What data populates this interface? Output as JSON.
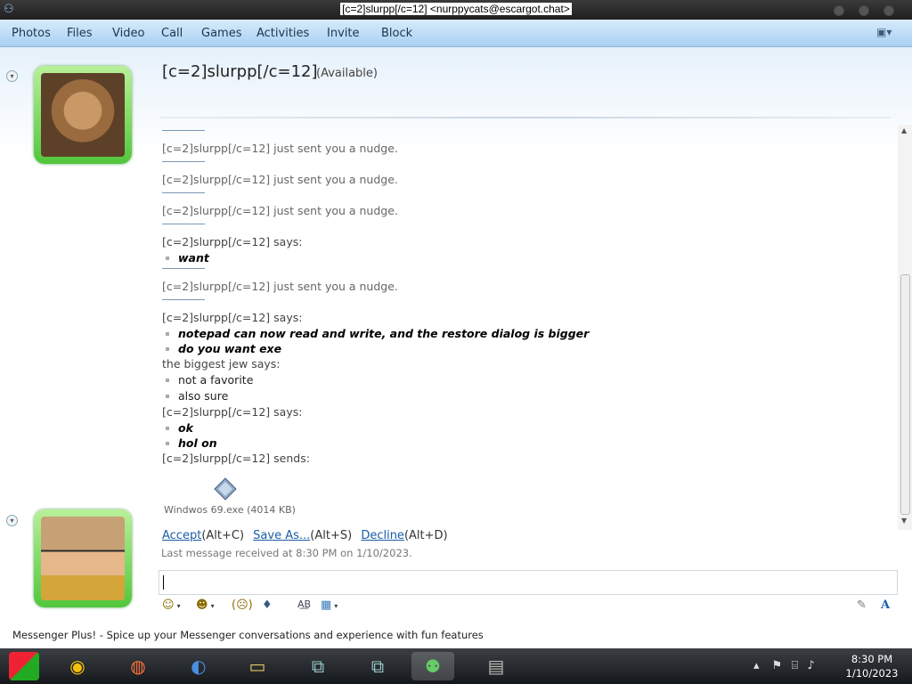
{
  "window": {
    "title": "[c=2]slurpp[/c=12] <nurppycats@escargot.chat>"
  },
  "menu": {
    "items": [
      "Photos",
      "Files",
      "Video",
      "Call",
      "Games",
      "Activities",
      "Invite",
      "Block"
    ]
  },
  "contact": {
    "name": "[c=2]slurpp[/c=12]",
    "status": "(Available)"
  },
  "conversation": {
    "nudges": [
      "[c=2]slurpp[/c=12] just sent you a nudge.",
      "[c=2]slurpp[/c=12] just sent you a nudge.",
      "[c=2]slurpp[/c=12] just sent you a nudge."
    ],
    "block1_says": "[c=2]slurpp[/c=12] says:",
    "block1_msg": "want",
    "nudge4": "[c=2]slurpp[/c=12] just sent you a nudge.",
    "block2_says": "[c=2]slurpp[/c=12] says:",
    "block2_msgs": [
      "notepad can now read and write, and the restore dialog is bigger",
      "do you want exe"
    ],
    "block3_says": "the biggest jew says:",
    "block3_msgs": [
      "not a favorite",
      "also sure"
    ],
    "block4_says": "[c=2]slurpp[/c=12] says:",
    "block4_msgs": [
      "ok",
      "hol on"
    ],
    "block5_sends": "[c=2]slurpp[/c=12] sends:"
  },
  "file_transfer": {
    "file": "Windwos 69.exe (4014 KB)",
    "accept": "Accept",
    "accept_key": "(Alt+C)",
    "save_as": "Save As...",
    "save_key": "(Alt+S)",
    "decline": "Decline",
    "decline_key": "(Alt+D)"
  },
  "status_line": "Last message received at 8:30 PM on 1/10/2023.",
  "plus_banner": "Messenger Plus! - Spice up your Messenger conversations and experience with fun features",
  "clock": {
    "time": "8:30 PM",
    "date": "1/10/2023"
  },
  "icons": {
    "emoticon": "smile-icon",
    "wink": "wink-icon",
    "nudge": "nudge-icon",
    "voice_clip": "voice-clip-icon",
    "spell": "spell-check-icon",
    "background": "background-icon",
    "handwriting": "pen-icon",
    "font": "font-icon"
  }
}
